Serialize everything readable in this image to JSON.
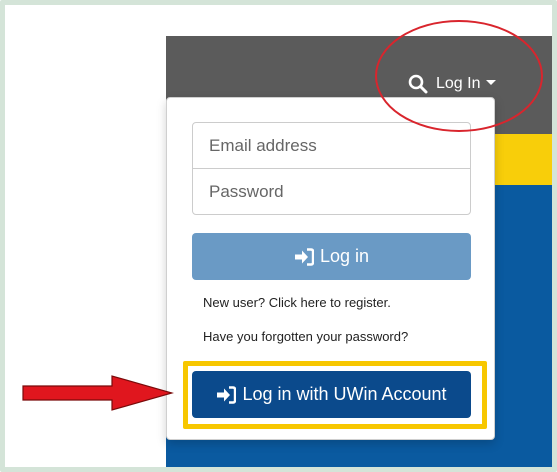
{
  "navbar": {
    "login_label": "Log In",
    "search_icon": "search-icon",
    "caret_icon": "caret-down-icon"
  },
  "login_form": {
    "email_placeholder": "Email address",
    "password_placeholder": "Password",
    "login_button_label": "Log in",
    "login_icon": "sign-in-icon",
    "register_link": "New user? Click here to register.",
    "forgot_link": "Have you forgotten your password?",
    "uwin_button_label": "Log in with UWin Account"
  },
  "annotations": {
    "ellipse_color": "#d9252d",
    "arrow_color": "#e0161e",
    "highlight_color": "#f7c700"
  },
  "colors": {
    "navbar": "#5b5b5b",
    "accent_yellow": "#f8ce0a",
    "brand_blue": "#0a5aa0",
    "login_button": "#6a9ac5",
    "uwin_button": "#0b4a8c"
  }
}
